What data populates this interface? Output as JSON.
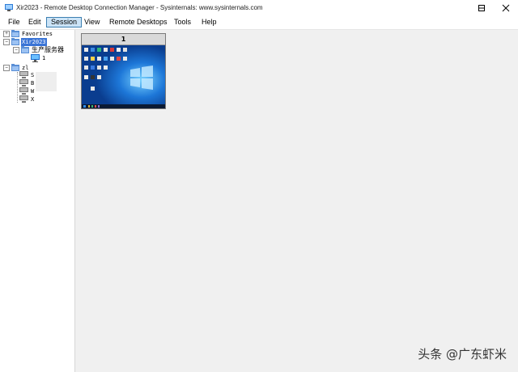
{
  "window": {
    "title": "Xir2023 - Remote Desktop Connection Manager - Sysinternals: www.sysinternals.com"
  },
  "menu": [
    "File",
    "Edit",
    "Session",
    "View",
    "Remote Desktops",
    "Tools",
    "Help"
  ],
  "menu_active": "Session",
  "tree": {
    "favorites": "Favorites",
    "group_root": "Xir2023",
    "subgroup": "生产服务器",
    "server1": "1",
    "group2": "zl",
    "group2_children": [
      "S",
      "B",
      "W",
      "X"
    ]
  },
  "thumbnail": {
    "title": "1"
  },
  "watermark": "头条 @广东虾米",
  "colors": {
    "selection": "#3a74d6",
    "desktop_bg": "#0d47a1",
    "active_menu": "#cce4f7"
  },
  "icons": [
    "app-icon",
    "minimize-icon",
    "maximize-icon",
    "close-icon",
    "folder-icon",
    "server-icon",
    "windows-logo-icon"
  ]
}
